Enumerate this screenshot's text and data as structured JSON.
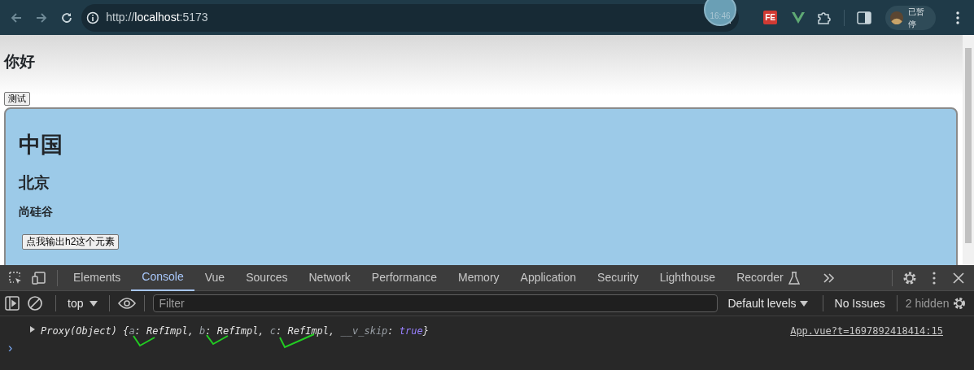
{
  "browser": {
    "url": "http://**localhost**:5173",
    "clock": "16:46",
    "extension_label": "FE",
    "profile_label": "已暂停"
  },
  "page": {
    "heading": "你好",
    "button": "测试",
    "card": {
      "title": "中国",
      "subtitle": "北京",
      "caption": "尚硅谷",
      "button": "点我输出h2这个元素"
    }
  },
  "devtools": {
    "tabs": [
      {
        "label": "Elements",
        "selected": false
      },
      {
        "label": "Console",
        "selected": true
      },
      {
        "label": "Vue",
        "selected": false
      },
      {
        "label": "Sources",
        "selected": false
      },
      {
        "label": "Network",
        "selected": false
      },
      {
        "label": "Performance",
        "selected": false
      },
      {
        "label": "Memory",
        "selected": false
      },
      {
        "label": "Application",
        "selected": false
      },
      {
        "label": "Security",
        "selected": false
      },
      {
        "label": "Lighthouse",
        "selected": false
      },
      {
        "label": "Recorder",
        "selected": false
      }
    ],
    "context": "top",
    "filter": {
      "placeholder": "Filter"
    },
    "levels": "Default levels",
    "issues": "No Issues",
    "hidden": "2 hidden",
    "messages": [
      {
        "parts": [
          {
            "kind": "plain",
            "text": "Proxy(Object) {"
          },
          {
            "kind": "key",
            "text": "a"
          },
          {
            "kind": "plain",
            "text": ": RefImpl, "
          },
          {
            "kind": "key",
            "text": "b"
          },
          {
            "kind": "plain",
            "text": ": RefImpl, "
          },
          {
            "kind": "key",
            "text": "c"
          },
          {
            "kind": "plain",
            "text": ": RefImpl, "
          },
          {
            "kind": "key",
            "text": "__v_skip"
          },
          {
            "kind": "plain",
            "text": ": "
          },
          {
            "kind": "bool",
            "text": "true"
          },
          {
            "kind": "plain",
            "text": "}"
          }
        ],
        "source": "App.vue?t=1697892418414:15"
      }
    ],
    "prompt": "›"
  }
}
